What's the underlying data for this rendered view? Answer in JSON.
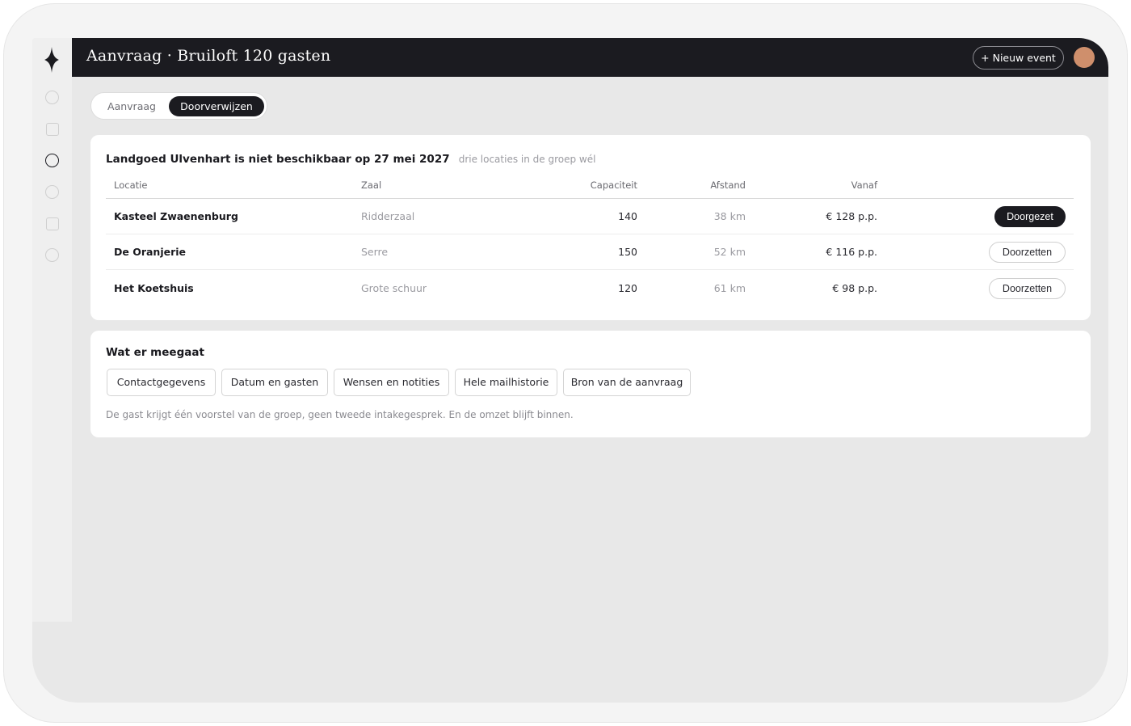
{
  "app": {
    "title": "Aanvraag · Bruiloft 120 gasten",
    "new_event_label": "+ Nieuw event",
    "avatar_color": "#cf8f6c",
    "accent_dark": "#1b1b20"
  },
  "rail": {
    "logo_icon": "four-point-star-icon",
    "items": [
      {
        "icon": "circle-icon",
        "active": false
      },
      {
        "icon": "square-icon",
        "active": false
      },
      {
        "icon": "circle-icon",
        "active": true
      },
      {
        "icon": "circle-icon",
        "active": false
      },
      {
        "icon": "square-icon",
        "active": false
      },
      {
        "icon": "circle-icon",
        "active": false
      }
    ]
  },
  "tabs": {
    "items": [
      {
        "label": "Aanvraag",
        "active": false
      },
      {
        "label": "Doorverwijzen",
        "active": true
      }
    ]
  },
  "referral": {
    "heading": "Landgoed Ulvenhart is niet beschikbaar op 27 mei 2027",
    "subheading": "drie locaties in de groep wél",
    "columns": [
      "Locatie",
      "Zaal",
      "Capaciteit",
      "Afstand",
      "Vanaf"
    ],
    "rows": [
      {
        "location": "Kasteel Zwaenenburg",
        "room": "Ridderzaal",
        "capacity": "140",
        "distance": "38 km",
        "price": "€ 128 p.p.",
        "action": "Doorgezet",
        "done": true
      },
      {
        "location": "De Oranjerie",
        "room": "Serre",
        "capacity": "150",
        "distance": "52 km",
        "price": "€ 116 p.p.",
        "action": "Doorzetten",
        "done": false
      },
      {
        "location": "Het Koetshuis",
        "room": "Grote schuur",
        "capacity": "120",
        "distance": "61 km",
        "price": "€ 98 p.p.",
        "action": "Doorzetten",
        "done": false
      }
    ]
  },
  "included": {
    "heading": "Wat er meegaat",
    "chips": [
      "Contactgegevens",
      "Datum en gasten",
      "Wensen en notities",
      "Hele mailhistorie",
      "Bron van de aanvraag"
    ],
    "note": "De gast krijgt één voorstel van de groep, geen tweede intakegesprek. En de omzet blijft binnen."
  }
}
